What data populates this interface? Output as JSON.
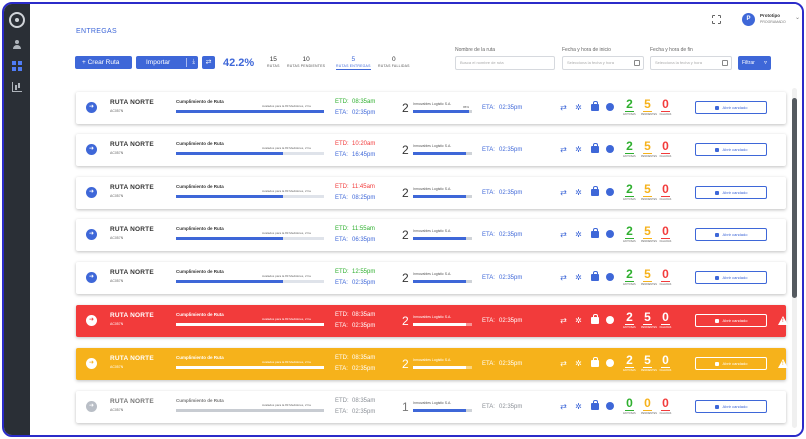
{
  "header": {
    "page_title": "ENTREGAS",
    "user": {
      "initial": "P",
      "name": "Prototipo",
      "role": "PROGRAMADO"
    }
  },
  "toolbar": {
    "create_label": "+ Crear Ruta",
    "import_label": "Importar",
    "kpi_percent": "42.2%",
    "stats": [
      {
        "value": "15",
        "label": "RUTAS"
      },
      {
        "value": "10",
        "label": "RUTAS PENDIENTES"
      },
      {
        "value": "5",
        "label": "RUTAS ENTREGAS"
      },
      {
        "value": "0",
        "label": "RUTAS FALLIDAS"
      }
    ]
  },
  "filters": {
    "route_name_label": "Nombre de la ruta",
    "route_name_placeholder": "Busca el nombre de ruta",
    "start_label": "Fecha y hora de inicio",
    "start_placeholder": "Selecciona la fecha y hora",
    "end_label": "Fecha y hora de fin",
    "end_placeholder": "Selecciona la fecha y hora",
    "filter_label": "Filtrar"
  },
  "colors": {
    "accent": "#3e67d8",
    "success": "#2eaf2e",
    "warning": "#f6b21b",
    "danger": "#f23b3b"
  },
  "rows": [
    {
      "name": "RUTA NORTE",
      "code": "AC057N",
      "compliance_label": "Cumplimiento de Ruta",
      "compliance_sub": "Avalados para la 83 Medidores, 2 ha",
      "progress": 1.0,
      "etd_key": "ETD:",
      "etd": "08:35am",
      "eta_key": "ETA:",
      "eta": "02:35pm",
      "stops": "2",
      "carrier": "Inmovables Logistic S.A.",
      "carrier_pct": "95%",
      "carrier_progress": 0.95,
      "eta2_key": "ETA:",
      "eta2": "02:35pm",
      "ok": "2",
      "pending": "5",
      "failed": "0",
      "ok_label": "EXITOSAS",
      "pending_label": "PENDIENTES",
      "failed_label": "FALLIDAS",
      "seal_label": "Abrir candado",
      "tone": "normal",
      "etd_tone": "green"
    },
    {
      "name": "RUTA NORTE",
      "code": "AC057N",
      "compliance_label": "Cumplimiento de Ruta",
      "compliance_sub": "Avalados para la 83 Medidores, 2 ha",
      "progress": 0.72,
      "etd_key": "ETD:",
      "etd": "10:20am",
      "eta_key": "ETA:",
      "eta": "16:45pm",
      "stops": "2",
      "carrier": "Inmovables Logistic S.A.",
      "carrier_pct": "",
      "carrier_progress": 0.9,
      "eta2_key": "ETA:",
      "eta2": "02:35pm",
      "ok": "2",
      "pending": "5",
      "failed": "0",
      "ok_label": "EXITOSAS",
      "pending_label": "PENDIENTES",
      "failed_label": "FALLIDAS",
      "seal_label": "Abrir candado",
      "tone": "normal",
      "etd_tone": "red"
    },
    {
      "name": "RUTA NORTE",
      "code": "AC057N",
      "compliance_label": "Cumplimiento de Ruta",
      "compliance_sub": "Avalados para la 83 Medidores, 2 ha",
      "progress": 0.72,
      "etd_key": "ETD:",
      "etd": "11:45am",
      "eta_key": "ETA:",
      "eta": "08:25pm",
      "stops": "2",
      "carrier": "Inmovables Logistic S.A.",
      "carrier_pct": "",
      "carrier_progress": 0.9,
      "eta2_key": "ETA:",
      "eta2": "02:35pm",
      "ok": "2",
      "pending": "5",
      "failed": "0",
      "ok_label": "EXITOSAS",
      "pending_label": "PENDIENTES",
      "failed_label": "FALLIDAS",
      "seal_label": "Abrir candado",
      "tone": "normal",
      "etd_tone": "red"
    },
    {
      "name": "RUTA NORTE",
      "code": "AC057N",
      "compliance_label": "Cumplimiento de Ruta",
      "compliance_sub": "Avalados para la 83 Medidores, 2 ha",
      "progress": 0.72,
      "etd_key": "ETD:",
      "etd": "11:55am",
      "eta_key": "ETA:",
      "eta": "06:35pm",
      "stops": "2",
      "carrier": "Inmovables Logistic S.A.",
      "carrier_pct": "",
      "carrier_progress": 0.9,
      "eta2_key": "ETA:",
      "eta2": "02:35pm",
      "ok": "2",
      "pending": "5",
      "failed": "0",
      "ok_label": "EXITOSAS",
      "pending_label": "PENDIENTES",
      "failed_label": "FALLIDAS",
      "seal_label": "Abrir candado",
      "tone": "normal",
      "etd_tone": "green"
    },
    {
      "name": "RUTA NORTE",
      "code": "AC057N",
      "compliance_label": "Cumplimiento de Ruta",
      "compliance_sub": "Avalados para la 83 Medidores, 2 ha",
      "progress": 0.72,
      "etd_key": "ETD:",
      "etd": "12:55pm",
      "eta_key": "ETA:",
      "eta": "02:35pm",
      "stops": "2",
      "carrier": "Inmovables Logistic S.A.",
      "carrier_pct": "",
      "carrier_progress": 0.9,
      "eta2_key": "ETA:",
      "eta2": "02:35pm",
      "ok": "2",
      "pending": "5",
      "failed": "0",
      "ok_label": "EXITOSAS",
      "pending_label": "PENDIENTES",
      "failed_label": "FALLIDAS",
      "seal_label": "Abrir candado",
      "tone": "normal",
      "etd_tone": "green"
    },
    {
      "name": "RUTA NORTE",
      "code": "AC057N",
      "compliance_label": "Cumplimiento de Ruta",
      "compliance_sub": "Avalados para la 83 Medidores, 2 ha",
      "progress": 1.0,
      "etd_key": "ETD:",
      "etd": "08:35am",
      "eta_key": "ETA:",
      "eta": "02:35pm",
      "stops": "2",
      "carrier": "Inmovables Logistic S.A.",
      "carrier_pct": "",
      "carrier_progress": 0.9,
      "eta2_key": "ETA:",
      "eta2": "02:35pm",
      "ok": "2",
      "pending": "5",
      "failed": "0",
      "ok_label": "EXITOSAS",
      "pending_label": "PENDIENTES",
      "failed_label": "FALLIDAS",
      "seal_label": "Abrir candado",
      "tone": "red",
      "etd_tone": "white"
    },
    {
      "name": "RUTA NORTE",
      "code": "AC057N",
      "compliance_label": "Cumplimiento de Ruta",
      "compliance_sub": "Avalados para la 83 Medidores, 2 ha",
      "progress": 1.0,
      "etd_key": "ETD:",
      "etd": "08:35am",
      "eta_key": "ETA:",
      "eta": "02:35pm",
      "stops": "2",
      "carrier": "Inmovables Logistic S.A.",
      "carrier_pct": "",
      "carrier_progress": 0.9,
      "eta2_key": "ETA:",
      "eta2": "02:35pm",
      "ok": "2",
      "pending": "5",
      "failed": "0",
      "ok_label": "EXITOSAS",
      "pending_label": "PENDIENTES",
      "failed_label": "FALLIDAS",
      "seal_label": "Abrir candado",
      "tone": "amber",
      "etd_tone": "white"
    },
    {
      "name": "RUTA NORTE",
      "code": "AC057N",
      "compliance_label": "Cumplimiento de Ruta",
      "compliance_sub": "Avalados para la 83 Medidores, 2 ha",
      "progress": 1.0,
      "etd_key": "ETD:",
      "etd": "08:35am",
      "eta_key": "ETA:",
      "eta": "02:35pm",
      "stops": "1",
      "carrier": "Inmovables Logistic S.A.",
      "carrier_pct": "",
      "carrier_progress": 0.9,
      "eta2_key": "ETA:",
      "eta2": "02:35pm",
      "ok": "0",
      "pending": "0",
      "failed": "0",
      "ok_label": "EXITOSAS",
      "pending_label": "PENDIENTES",
      "failed_label": "FALLIDAS",
      "seal_label": "Abrir candado",
      "tone": "muted",
      "etd_tone": "muted"
    }
  ]
}
